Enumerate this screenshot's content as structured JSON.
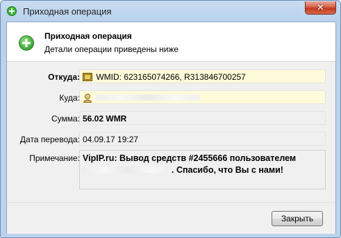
{
  "window": {
    "title": "Приходная операция",
    "close_label": "✕"
  },
  "header": {
    "title": "Приходная операция",
    "subtitle": "Детали операции приведены ниже"
  },
  "form": {
    "from_label": "Откуда:",
    "from_value": "WMID: 623165074266, R313846700257",
    "to_label": "Куда:",
    "to_value": "",
    "amount_label": "Сумма:",
    "amount_value": "56.02 WMR",
    "date_label": "Дата перевода:",
    "date_value": "04.09.17 19:27",
    "note_label": "Примечание:",
    "note_line1": "VipIP.ru: Вывод средств #2455666 пользователем",
    "note_line2": ". Спасибо, что Вы с нами!"
  },
  "footer": {
    "close_button": "Закрыть"
  },
  "colors": {
    "accent_green": "#3db43a",
    "highlight_field": "#fdfbd9",
    "close_button_red": "#c4371c"
  },
  "icons": {
    "title": "plus-circle-icon",
    "header": "plus-circle-icon",
    "from": "wallet-icon",
    "to": "user-icon"
  }
}
